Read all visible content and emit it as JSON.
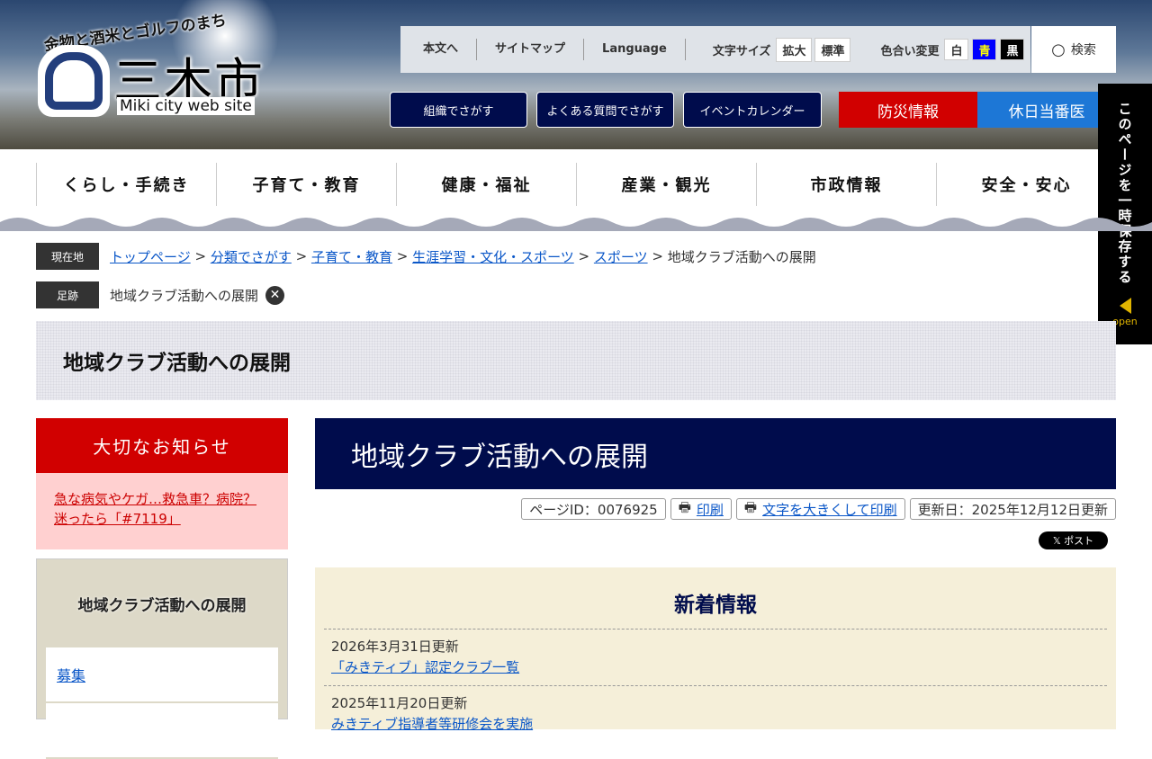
{
  "header": {
    "tagline": "金物と酒米とゴルフのまち",
    "city_name": "三木市",
    "city_sub": "Miki city web site",
    "util_links": [
      "本文へ",
      "サイトマップ",
      "Language"
    ],
    "font_size_label": "文字サイズ",
    "font_size_buttons": [
      "拡大",
      "標準"
    ],
    "color_label": "色合い変更",
    "color_buttons": [
      "白",
      "青",
      "黒"
    ],
    "search_label": "検索",
    "nav_buttons": [
      "組織でさがす",
      "よくある質問でさがす",
      "イベントカレンダー"
    ],
    "disaster_label": "防災情報",
    "holiday_doctor_label": "休日当番医"
  },
  "side_tab": {
    "label": "このページを一時保存する",
    "open": "open"
  },
  "global_nav": [
    "くらし・手続き",
    "子育て・教育",
    "健康・福祉",
    "産業・観光",
    "市政情報",
    "安全・安心"
  ],
  "breadcrumb": {
    "tag": "現在地",
    "items": [
      "トップページ",
      "分類でさがす",
      "子育て・教育",
      "生涯学習・文化・スポーツ",
      "スポーツ"
    ],
    "current": "地域クラブ活動への展開",
    "sep": " > "
  },
  "footprint": {
    "tag": "足跡",
    "item": "地域クラブ活動への展開",
    "close": "✕"
  },
  "page_title": "地域クラブ活動への展開",
  "notice": {
    "title": "大切なお知らせ",
    "link_line1": "急な病気やケガ…救急車？病院？",
    "link_line2": "迷ったら「#7119」"
  },
  "subnav": {
    "title": "地域クラブ活動への展開",
    "items": [
      "募集"
    ]
  },
  "main": {
    "title": "地域クラブ活動への展開",
    "page_id": "ページID：0076925",
    "print": "印刷",
    "print_large": "文字を大きくして印刷",
    "updated": "更新日：2025年12月12日更新",
    "post": "𝕏 ポスト",
    "news_title": "新着情報",
    "news": [
      {
        "date": "2026年3月31日更新",
        "link": "「みきティブ」認定クラブ一覧"
      },
      {
        "date": "2025年11月20日更新",
        "link": "みきティブ指導者等研修会を実施"
      }
    ]
  }
}
